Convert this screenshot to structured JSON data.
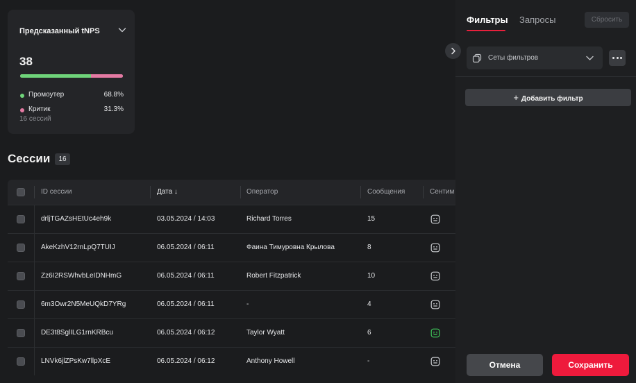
{
  "tnps_card": {
    "title": "Предсказанный tNPS",
    "value": "38",
    "promoter": {
      "label": "Промоутер",
      "percent": "68.8%",
      "share": 0.688,
      "color": "#6fd47a"
    },
    "critic": {
      "label": "Критик",
      "percent": "31.3%",
      "share": 0.313,
      "color": "#e47aa3"
    },
    "footer": "16 сессий"
  },
  "sessions": {
    "title": "Сессии",
    "count": "16",
    "columns": [
      "ID сессии",
      "Дата ↓",
      "Оператор",
      "Сообщения",
      "Сентим"
    ],
    "rows": [
      {
        "id": "drljTGAZsHEtUc4eh9k",
        "date": "03.05.2024 / 14:03",
        "operator": "Richard Torres",
        "messages": "15",
        "sentiment": "neutral"
      },
      {
        "id": "AkeKzhV12rnLpQ7TUIJ",
        "date": "06.05.2024 / 06:11",
        "operator": "Фаина Тимуровна Крылова",
        "messages": "8",
        "sentiment": "neutral"
      },
      {
        "id": "Zz6I2RSWhvbLeIDNHmG",
        "date": "06.05.2024 / 06:11",
        "operator": "Robert Fitzpatrick",
        "messages": "10",
        "sentiment": "neutral"
      },
      {
        "id": "6m3Owr2N5MeUQkD7YRg",
        "date": "06.05.2024 / 06:11",
        "operator": "-",
        "messages": "4",
        "sentiment": "neutral"
      },
      {
        "id": "DE3t8SglILG1rnKRBcu",
        "date": "06.05.2024 / 06:12",
        "operator": "Taylor Wyatt",
        "messages": "6",
        "sentiment": "positive"
      },
      {
        "id": "LNVk6jlZPsKw7llpXcE",
        "date": "06.05.2024 / 06:12",
        "operator": "Anthony Howell",
        "messages": "-",
        "sentiment": "neutral"
      }
    ]
  },
  "panel": {
    "tab_filters": "Фильтры",
    "tab_queries": "Запросы",
    "reset": "Сбросить",
    "filter_sets": "Сеты фильтров",
    "add_filter": "Добавить фильтр",
    "cancel": "Отмена",
    "save": "Сохранить"
  },
  "colors": {
    "accent": "#ee1a3c",
    "positive": "#3fc65a",
    "neutral_icon": "#c9cbcf"
  }
}
